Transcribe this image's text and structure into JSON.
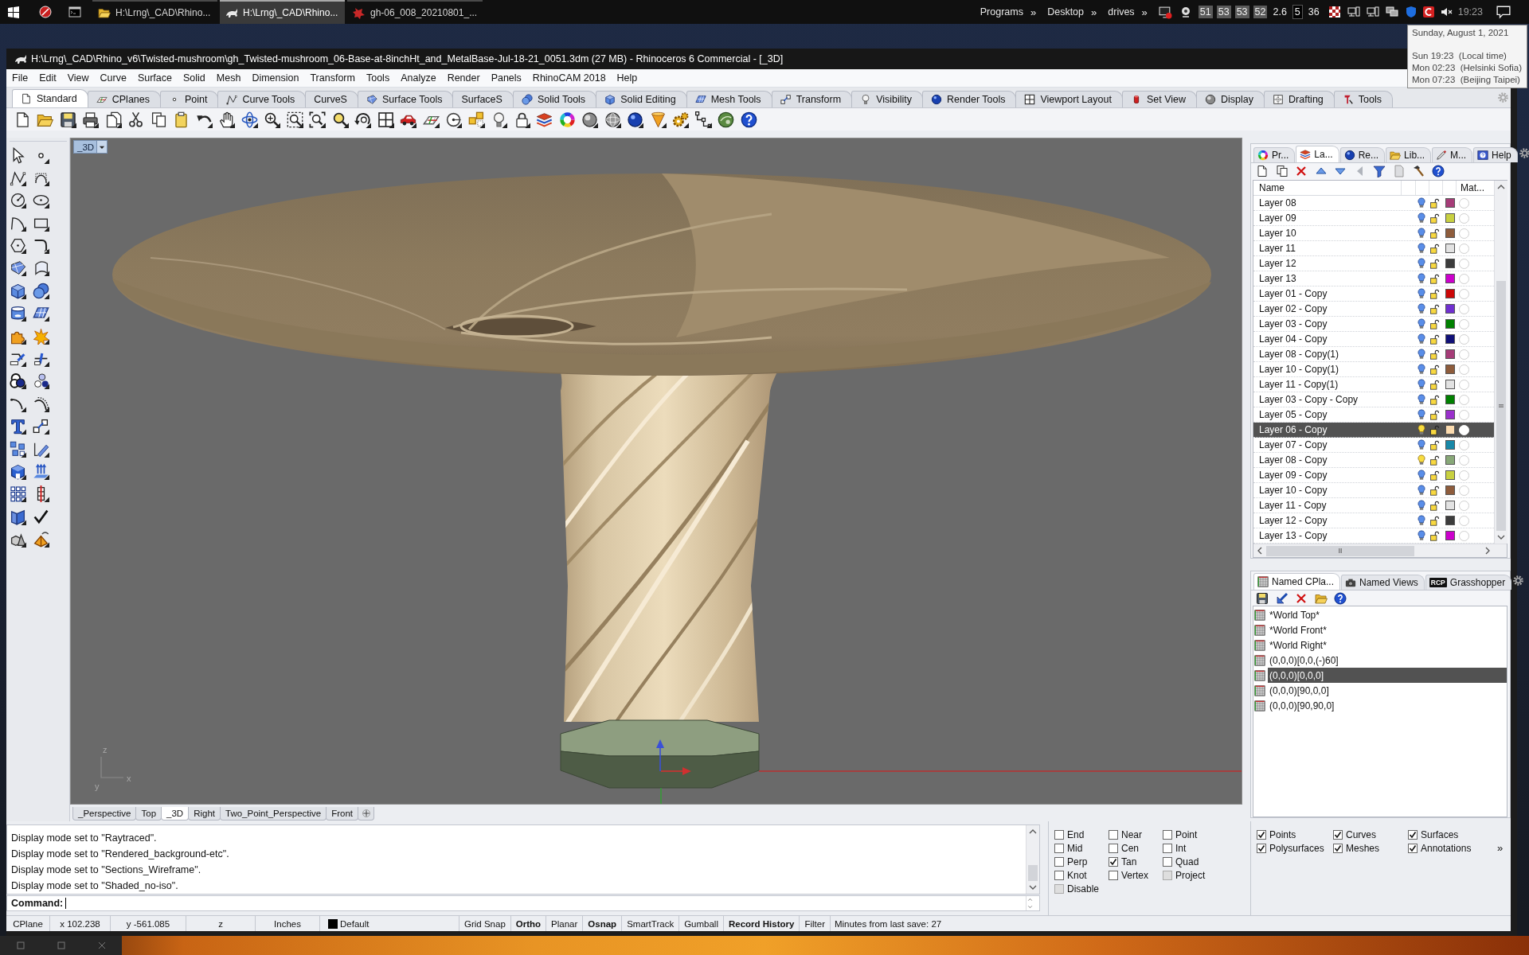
{
  "taskbar": {
    "tasks": [
      {
        "label": "H:\\Lrng\\_CAD\\Rhino...",
        "selected": false
      },
      {
        "label": "H:\\Lrng\\_CAD\\Rhino...",
        "selected": true
      },
      {
        "label": "gh-06_008_20210801_...",
        "selected": false
      }
    ],
    "toolbars": [
      {
        "label": "Programs",
        "chevron": "»"
      },
      {
        "label": "Desktop",
        "chevron": "»"
      },
      {
        "label": "drives",
        "chevron": "»"
      }
    ],
    "readings": [
      {
        "text": "51",
        "kind": "boxed"
      },
      {
        "text": "53",
        "kind": "boxed"
      },
      {
        "text": "53",
        "kind": "boxed"
      },
      {
        "text": "52",
        "kind": "boxed"
      },
      {
        "text": "2.6",
        "kind": "plain"
      },
      {
        "text": "5",
        "kind": "dark"
      },
      {
        "text": "36",
        "kind": "plain"
      }
    ],
    "clock": "19:23"
  },
  "clock_tooltip": {
    "date": "Sunday, August 1, 2021",
    "times": [
      "Sun 19:23  (Local time)",
      "Mon 02:23  (Helsinki Sofia)",
      "Mon 07:23  (Beijing Taipei)"
    ]
  },
  "window": {
    "title": "H:\\Lrng\\_CAD\\Rhino_v6\\Twisted-mushroom\\gh_Twisted-mushroom_06-Base-at-8inchHt_and_MetalBase-Jul-18-21_0051.3dm (27 MB) - Rhinoceros 6 Commercial - [_3D]"
  },
  "menu": [
    "File",
    "Edit",
    "View",
    "Curve",
    "Surface",
    "Solid",
    "Mesh",
    "Dimension",
    "Transform",
    "Tools",
    "Analyze",
    "Render",
    "Panels",
    "RhinoCAM 2018",
    "Help"
  ],
  "toolbar_tabs": [
    {
      "label": "Standard",
      "selected": true
    },
    {
      "label": "CPlanes",
      "selected": false
    },
    {
      "label": "Point",
      "selected": false
    },
    {
      "label": "Curve Tools",
      "selected": false
    },
    {
      "label": "CurveS",
      "selected": false
    },
    {
      "label": "Surface Tools",
      "selected": false
    },
    {
      "label": "SurfaceS",
      "selected": false
    },
    {
      "label": "Solid Tools",
      "selected": false
    },
    {
      "label": "Solid Editing",
      "selected": false
    },
    {
      "label": "Mesh Tools",
      "selected": false
    },
    {
      "label": "Transform",
      "selected": false
    },
    {
      "label": "Visibility",
      "selected": false
    },
    {
      "label": "Render Tools",
      "selected": false
    },
    {
      "label": "Viewport Layout",
      "selected": false
    },
    {
      "label": "Set View",
      "selected": false
    },
    {
      "label": "Display",
      "selected": false
    },
    {
      "label": "Drafting",
      "selected": false
    },
    {
      "label": "Tools",
      "selected": false
    }
  ],
  "viewport": {
    "title": "_3D",
    "axis_labels": [
      "z",
      "x",
      "y"
    ]
  },
  "viewport_tabs": [
    {
      "label": "_Perspective",
      "selected": false
    },
    {
      "label": "Top",
      "selected": false
    },
    {
      "label": "_3D",
      "selected": true
    },
    {
      "label": "Right",
      "selected": false
    },
    {
      "label": "Two_Point_Perspective",
      "selected": false
    },
    {
      "label": "Front",
      "selected": false
    }
  ],
  "layers_panel": {
    "tabs": [
      {
        "label": "Pr...",
        "selected": false
      },
      {
        "label": "La...",
        "selected": true
      },
      {
        "label": "Re...",
        "selected": false
      },
      {
        "label": "Lib...",
        "selected": false
      },
      {
        "label": "M...",
        "selected": false
      },
      {
        "label": "Help",
        "selected": false
      }
    ],
    "columns": [
      "Name",
      "Mat..."
    ],
    "rows": [
      {
        "name": "Layer 08",
        "lit": false,
        "locked": false,
        "color": "#a63c78",
        "selected": false
      },
      {
        "name": "Layer 09",
        "lit": false,
        "locked": false,
        "color": "#c8d040",
        "selected": false
      },
      {
        "name": "Layer 10",
        "lit": false,
        "locked": false,
        "color": "#8e5c3c",
        "selected": false
      },
      {
        "name": "Layer 11",
        "lit": false,
        "locked": false,
        "color": "#e2e2e2",
        "selected": false
      },
      {
        "name": "Layer 12",
        "lit": false,
        "locked": false,
        "color": "#3c3c3c",
        "selected": false
      },
      {
        "name": "Layer 13",
        "lit": false,
        "locked": false,
        "color": "#cc00cc",
        "selected": false
      },
      {
        "name": "Layer 01 - Copy",
        "lit": false,
        "locked": false,
        "color": "#cc0808",
        "selected": false
      },
      {
        "name": "Layer 02 - Copy",
        "lit": false,
        "locked": false,
        "color": "#7030d0",
        "selected": false
      },
      {
        "name": "Layer 03 - Copy",
        "lit": false,
        "locked": false,
        "color": "#008000",
        "selected": false
      },
      {
        "name": "Layer 04 - Copy",
        "lit": false,
        "locked": false,
        "color": "#101078",
        "selected": false
      },
      {
        "name": "Layer 08 - Copy(1)",
        "lit": false,
        "locked": false,
        "color": "#a63c78",
        "selected": false
      },
      {
        "name": "Layer 10 - Copy(1)",
        "lit": false,
        "locked": false,
        "color": "#8e5c3c",
        "selected": false
      },
      {
        "name": "Layer 11 - Copy(1)",
        "lit": false,
        "locked": false,
        "color": "#e2e2e2",
        "selected": false
      },
      {
        "name": "Layer 03 - Copy - Copy",
        "lit": false,
        "locked": false,
        "color": "#008000",
        "selected": false
      },
      {
        "name": "Layer 05 - Copy",
        "lit": false,
        "locked": false,
        "color": "#9a30cc",
        "selected": false
      },
      {
        "name": "Layer 06 - Copy",
        "lit": true,
        "locked": false,
        "color": "#fcdcb0",
        "selected": true
      },
      {
        "name": "Layer 07 - Copy",
        "lit": false,
        "locked": false,
        "color": "#1888a8",
        "selected": false
      },
      {
        "name": "Layer 08 - Copy",
        "lit": true,
        "locked": false,
        "color": "#88a878",
        "selected": false
      },
      {
        "name": "Layer 09 - Copy",
        "lit": false,
        "locked": false,
        "color": "#c8d040",
        "selected": false
      },
      {
        "name": "Layer 10 - Copy",
        "lit": false,
        "locked": false,
        "color": "#8e5c3c",
        "selected": false
      },
      {
        "name": "Layer 11 - Copy",
        "lit": false,
        "locked": false,
        "color": "#e2e2e2",
        "selected": false
      },
      {
        "name": "Layer 12 - Copy",
        "lit": false,
        "locked": false,
        "color": "#3c3c3c",
        "selected": false
      },
      {
        "name": "Layer 13 - Copy",
        "lit": false,
        "locked": false,
        "color": "#cc00cc",
        "selected": false
      }
    ]
  },
  "cplanes_panel": {
    "tabs": [
      {
        "label": "Named CPla...",
        "selected": true
      },
      {
        "label": "Named Views",
        "selected": false
      },
      {
        "label": "Grasshopper",
        "badge": "RCP",
        "selected": false
      }
    ],
    "items": [
      {
        "label": "*World Top*",
        "selected": false
      },
      {
        "label": "*World Front*",
        "selected": false
      },
      {
        "label": "*World Right*",
        "selected": false
      },
      {
        "label": "(0,0,0)[0,0,(-)60]",
        "selected": false
      },
      {
        "label": "(0,0,0)[0,0,0]",
        "selected": true
      },
      {
        "label": "(0,0,0)[90,0,0]",
        "selected": false
      },
      {
        "label": "(0,0,0)[90,90,0]",
        "selected": false
      }
    ]
  },
  "command": {
    "history": [
      "Display mode set to \"Raytraced\".",
      "Display mode set to \"Rendered_background-etc\".",
      "Display mode set to \"Sections_Wireframe\".",
      "Display mode set to \"Shaded_no-iso\"."
    ],
    "prompt": "Command:"
  },
  "osnaps": [
    {
      "label": "End",
      "checked": false,
      "disabled": false
    },
    {
      "label": "Near",
      "checked": false,
      "disabled": false
    },
    {
      "label": "Point",
      "checked": false,
      "disabled": false
    },
    {
      "label": "Mid",
      "checked": false,
      "disabled": false
    },
    {
      "label": "Cen",
      "checked": false,
      "disabled": false
    },
    {
      "label": "Int",
      "checked": false,
      "disabled": false
    },
    {
      "label": "Perp",
      "checked": false,
      "disabled": false
    },
    {
      "label": "Tan",
      "checked": true,
      "disabled": false
    },
    {
      "label": "Quad",
      "checked": false,
      "disabled": false
    },
    {
      "label": "Knot",
      "checked": false,
      "disabled": false
    },
    {
      "label": "Vertex",
      "checked": false,
      "disabled": false
    },
    {
      "label": "Project",
      "checked": false,
      "disabled": true
    },
    {
      "label": "Disable",
      "checked": false,
      "disabled": true
    }
  ],
  "filters": {
    "items": [
      {
        "label": "Points",
        "checked": true
      },
      {
        "label": "Curves",
        "checked": true
      },
      {
        "label": "Surfaces",
        "checked": true
      },
      {
        "label": "Polysurfaces",
        "checked": true
      },
      {
        "label": "Meshes",
        "checked": true
      },
      {
        "label": "Annotations",
        "checked": true
      }
    ],
    "more": "»"
  },
  "status_bar": {
    "cplane": "CPlane",
    "x": "x 102.238",
    "y": "y -561.085",
    "z": "z",
    "units": "Inches",
    "layer": "Default",
    "toggles": [
      {
        "label": "Grid Snap",
        "on": false
      },
      {
        "label": "Ortho",
        "on": true
      },
      {
        "label": "Planar",
        "on": false
      },
      {
        "label": "Osnap",
        "on": true
      },
      {
        "label": "SmartTrack",
        "on": false
      },
      {
        "label": "Gumball",
        "on": false
      },
      {
        "label": "Record History",
        "on": true
      },
      {
        "label": "Filter",
        "on": false
      }
    ],
    "save_info": "Minutes from last save: 27"
  }
}
